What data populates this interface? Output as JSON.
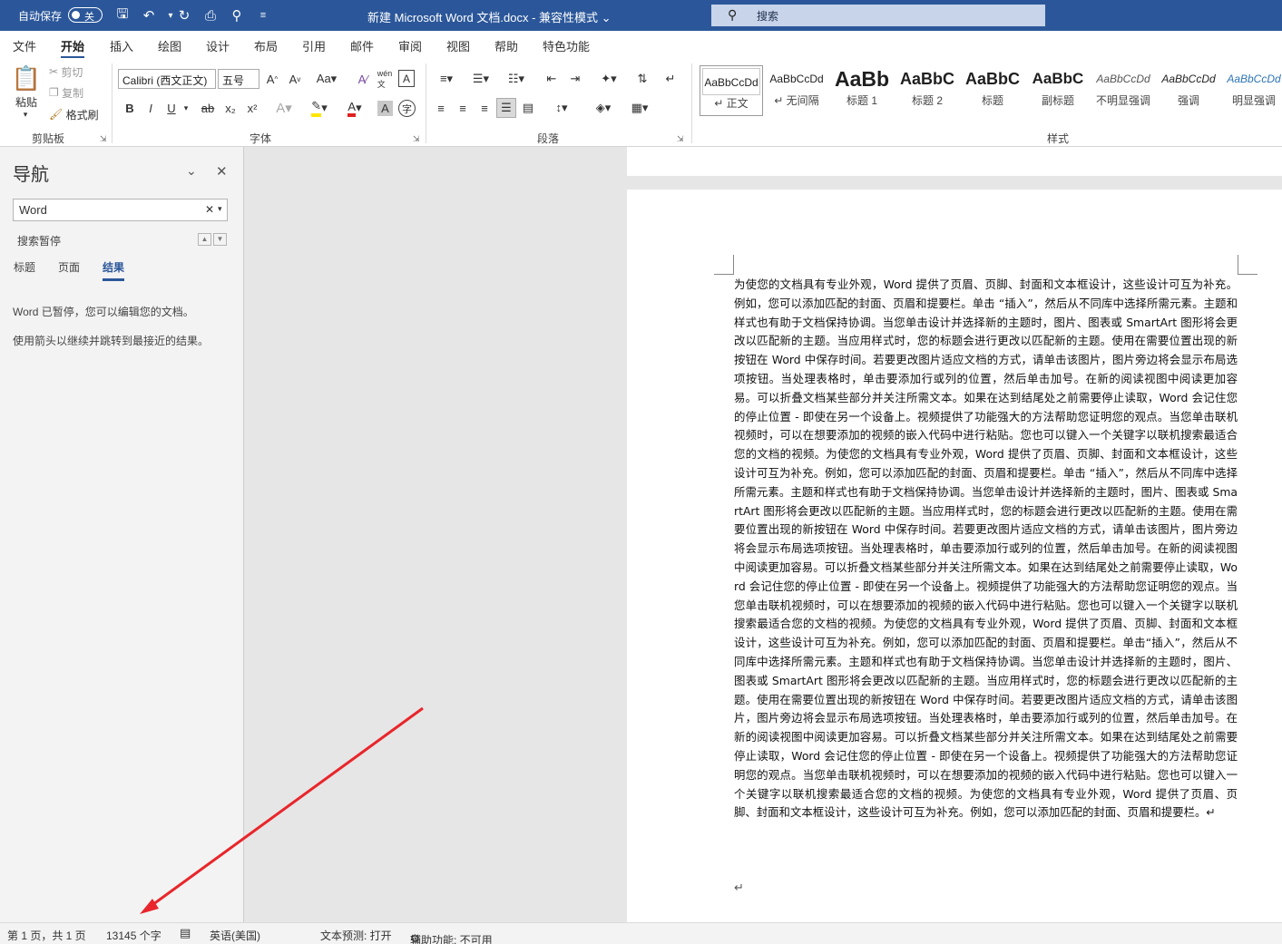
{
  "titlebar": {
    "autosave_label": "自动保存",
    "autosave_state": "关",
    "document_title": "新建 Microsoft Word 文档.docx  -  兼容性模式",
    "search_placeholder": "搜索"
  },
  "ribbon_tabs": [
    "文件",
    "开始",
    "插入",
    "绘图",
    "设计",
    "布局",
    "引用",
    "邮件",
    "审阅",
    "视图",
    "帮助",
    "特色功能"
  ],
  "ribbon": {
    "clipboard": {
      "paste": "粘贴",
      "cut": "剪切",
      "copy": "复制",
      "format_painter": "格式刷",
      "group": "剪贴板"
    },
    "font": {
      "font_name": "Calibri (西文正文)",
      "font_size": "五号",
      "group": "字体",
      "bold": "B",
      "italic": "I",
      "underline": "U",
      "strike": "ab",
      "subscript": "x₂",
      "superscript": "x²"
    },
    "paragraph": {
      "group": "段落"
    },
    "styles": {
      "group": "样式",
      "items": [
        {
          "sample": "AaBbCcDd",
          "label": "↵ 正文"
        },
        {
          "sample": "AaBbCcDd",
          "label": "↵ 无间隔"
        },
        {
          "sample": "AaBb",
          "label": "标题 1"
        },
        {
          "sample": "AaBbC",
          "label": "标题 2"
        },
        {
          "sample": "AaBbC",
          "label": "标题"
        },
        {
          "sample": "AaBbC",
          "label": "副标题"
        },
        {
          "sample": "AaBbCcDd",
          "label": "不明显强调"
        },
        {
          "sample": "AaBbCcDd",
          "label": "强调"
        },
        {
          "sample": "AaBbCcDd",
          "label": "明显强调"
        }
      ]
    }
  },
  "nav": {
    "title": "导航",
    "search_value": "Word",
    "paused_label": "搜索暂停",
    "tabs": [
      "标题",
      "页面",
      "结果"
    ],
    "message1": "Word 已暂停，您可以编辑您的文档。",
    "message2": "使用箭头以继续并跳转到最接近的结果。"
  },
  "document": {
    "body": "为使您的文档具有专业外观，Word 提供了页眉、页脚、封面和文本框设计，这些设计可互为补充。例如，您可以添加匹配的封面、页眉和提要栏。单击 “插入”，然后从不同库中选择所需元素。主题和样式也有助于文档保持协调。当您单击设计并选择新的主题时，图片、图表或 SmartArt 图形将会更改以匹配新的主题。当应用样式时，您的标题会进行更改以匹配新的主题。使用在需要位置出现的新按钮在 Word 中保存时间。若要更改图片适应文档的方式，请单击该图片，图片旁边将会显示布局选项按钮。当处理表格时，单击要添加行或列的位置，然后单击加号。在新的阅读视图中阅读更加容易。可以折叠文档某些部分并关注所需文本。如果在达到结尾处之前需要停止读取，Word 会记住您的停止位置 - 即使在另一个设备上。视频提供了功能强大的方法帮助您证明您的观点。当您单击联机视频时，可以在想要添加的视频的嵌入代码中进行粘贴。您也可以键入一个关键字以联机搜索最适合您的文档的视频。为使您的文档具有专业外观，Word 提供了页眉、页脚、封面和文本框设计，这些设计可互为补充。例如，您可以添加匹配的封面、页眉和提要栏。单击 “插入”，然后从不同库中选择所需元素。主题和样式也有助于文档保持协调。当您单击设计并选择新的主题时，图片、图表或 SmartArt 图形将会更改以匹配新的主题。当应用样式时，您的标题会进行更改以匹配新的主题。使用在需要位置出现的新按钮在 Word 中保存时间。若要更改图片适应文档的方式，请单击该图片，图片旁边将会显示布局选项按钮。当处理表格时，单击要添加行或列的位置，然后单击加号。在新的阅读视图中阅读更加容易。可以折叠文档某些部分并关注所需文本。如果在达到结尾处之前需要停止读取，Word 会记住您的停止位置 - 即使在另一个设备上。视频提供了功能强大的方法帮助您证明您的观点。当您单击联机视频时，可以在想要添加的视频的嵌入代码中进行粘贴。您也可以键入一个关键字以联机搜索最适合您的文档的视频。为使您的文档具有专业外观，Word 提供了页眉、页脚、封面和文本框设计，这些设计可互为补充。例如，您可以添加匹配的封面、页眉和提要栏。单击“插入”，然后从不同库中选择所需元素。主题和样式也有助于文档保持协调。当您单击设计并选择新的主题时，图片、图表或 SmartArt 图形将会更改以匹配新的主题。当应用样式时，您的标题会进行更改以匹配新的主题。使用在需要位置出现的新按钮在 Word 中保存时间。若要更改图片适应文档的方式，请单击该图片，图片旁边将会显示布局选项按钮。当处理表格时，单击要添加行或列的位置，然后单击加号。在新的阅读视图中阅读更加容易。可以折叠文档某些部分并关注所需文本。如果在达到结尾处之前需要停止读取，Word 会记住您的停止位置 - 即使在另一个设备上。视频提供了功能强大的方法帮助您证明您的观点。当您单击联机视频时，可以在想要添加的视频的嵌入代码中进行粘贴。您也可以键入一个关键字以联机搜索最适合您的文档的视频。为使您的文档具有专业外观，Word 提供了页眉、页脚、封面和文本框设计，这些设计可互为补充。例如，您可以添加匹配的封面、页眉和提要栏。↵"
  },
  "status": {
    "page": "第 1 页，共 1 页",
    "words": "13145 个字",
    "language": "英语(美国)",
    "text_prediction": "文本预测: 打开",
    "accessibility": "辅助功能: 不可用"
  },
  "colors": {
    "brand": "#2b579a",
    "arrow": "#e8262b"
  }
}
